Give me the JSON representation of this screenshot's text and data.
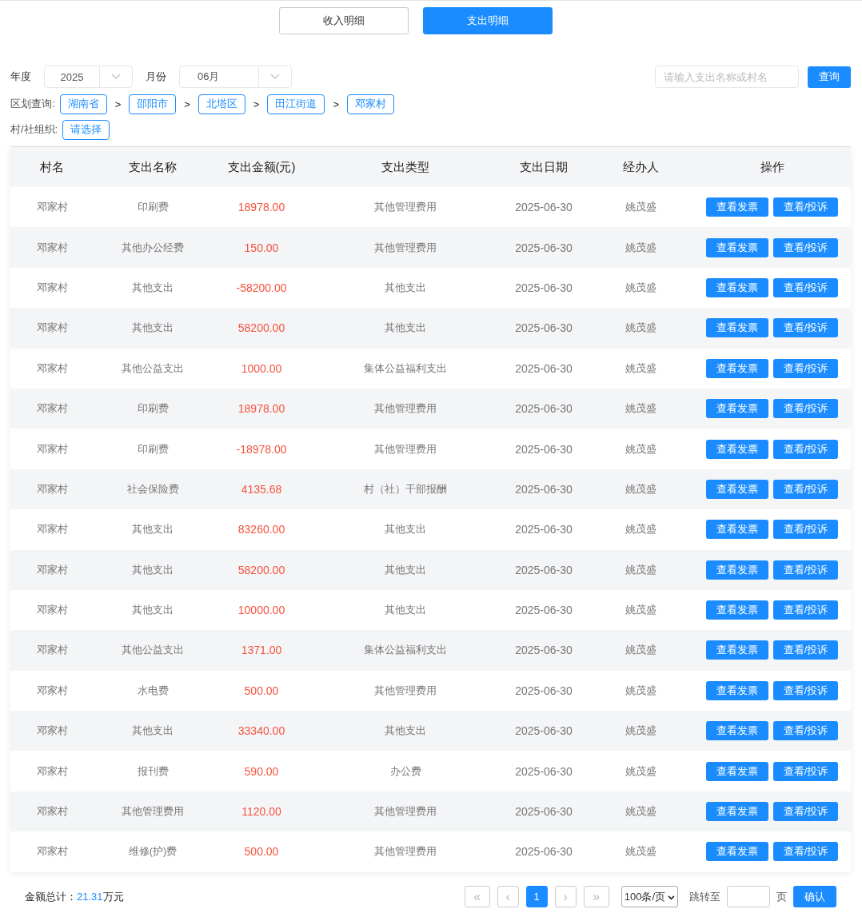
{
  "tabs": [
    {
      "label": "收入明细",
      "selected": false
    },
    {
      "label": "支出明细",
      "selected": true
    }
  ],
  "filters": {
    "year": {
      "label": "年度",
      "value": "2025"
    },
    "month": {
      "label": "月份",
      "value": "06月"
    },
    "search": {
      "placeholder": "请输入支出名称或村名"
    },
    "search_button": "查询"
  },
  "region": {
    "label": "区划查询:",
    "separator": ">",
    "items": [
      "湖南省",
      "邵阳市",
      "北塔区",
      "田江街道",
      "邓家村"
    ]
  },
  "organization": {
    "label": "村/社组织:",
    "value": "请选择"
  },
  "table": {
    "columns": [
      "村名",
      "支出名称",
      "支出金额(元)",
      "支出类型",
      "支出日期",
      "经办人",
      "操作"
    ],
    "rows": [
      {
        "village": "邓家村",
        "name": "印刷费",
        "amount": "18978.00",
        "type": "其他管理费用",
        "date": "2025-06-30",
        "handler": "姚茂盛",
        "actions": [
          "查看发票",
          "查看/投诉"
        ]
      },
      {
        "village": "邓家村",
        "name": "其他办公经费",
        "amount": "150.00",
        "type": "其他管理费用",
        "date": "2025-06-30",
        "handler": "姚茂盛",
        "actions": [
          "查看发票",
          "查看/投诉"
        ]
      },
      {
        "village": "邓家村",
        "name": "其他支出",
        "amount": "-58200.00",
        "type": "其他支出",
        "date": "2025-06-30",
        "handler": "姚茂盛",
        "actions": [
          "查看发票",
          "查看/投诉"
        ]
      },
      {
        "village": "邓家村",
        "name": "其他支出",
        "amount": "58200.00",
        "type": "其他支出",
        "date": "2025-06-30",
        "handler": "姚茂盛",
        "actions": [
          "查看发票",
          "查看/投诉"
        ]
      },
      {
        "village": "邓家村",
        "name": "其他公益支出",
        "amount": "1000.00",
        "type": "集体公益福利支出",
        "date": "2025-06-30",
        "handler": "姚茂盛",
        "actions": [
          "查看发票",
          "查看/投诉"
        ]
      },
      {
        "village": "邓家村",
        "name": "印刷费",
        "amount": "18978.00",
        "type": "其他管理费用",
        "date": "2025-06-30",
        "handler": "姚茂盛",
        "actions": [
          "查看发票",
          "查看/投诉"
        ]
      },
      {
        "village": "邓家村",
        "name": "印刷费",
        "amount": "-18978.00",
        "type": "其他管理费用",
        "date": "2025-06-30",
        "handler": "姚茂盛",
        "actions": [
          "查看发票",
          "查看/投诉"
        ]
      },
      {
        "village": "邓家村",
        "name": "社会保险费",
        "amount": "4135.68",
        "type": "村（社）干部报酬",
        "date": "2025-06-30",
        "handler": "姚茂盛",
        "actions": [
          "查看发票",
          "查看/投诉"
        ]
      },
      {
        "village": "邓家村",
        "name": "其他支出",
        "amount": "83260.00",
        "type": "其他支出",
        "date": "2025-06-30",
        "handler": "姚茂盛",
        "actions": [
          "查看发票",
          "查看/投诉"
        ]
      },
      {
        "village": "邓家村",
        "name": "其他支出",
        "amount": "58200.00",
        "type": "其他支出",
        "date": "2025-06-30",
        "handler": "姚茂盛",
        "actions": [
          "查看发票",
          "查看/投诉"
        ]
      },
      {
        "village": "邓家村",
        "name": "其他支出",
        "amount": "10000.00",
        "type": "其他支出",
        "date": "2025-06-30",
        "handler": "姚茂盛",
        "actions": [
          "查看发票",
          "查看/投诉"
        ]
      },
      {
        "village": "邓家村",
        "name": "其他公益支出",
        "amount": "1371.00",
        "type": "集体公益福利支出",
        "date": "2025-06-30",
        "handler": "姚茂盛",
        "actions": [
          "查看发票",
          "查看/投诉"
        ]
      },
      {
        "village": "邓家村",
        "name": "水电费",
        "amount": "500.00",
        "type": "其他管理费用",
        "date": "2025-06-30",
        "handler": "姚茂盛",
        "actions": [
          "查看发票",
          "查看/投诉"
        ]
      },
      {
        "village": "邓家村",
        "name": "其他支出",
        "amount": "33340.00",
        "type": "其他支出",
        "date": "2025-06-30",
        "handler": "姚茂盛",
        "actions": [
          "查看发票",
          "查看/投诉"
        ]
      },
      {
        "village": "邓家村",
        "name": "报刊费",
        "amount": "590.00",
        "type": "办公费",
        "date": "2025-06-30",
        "handler": "姚茂盛",
        "actions": [
          "查看发票",
          "查看/投诉"
        ]
      },
      {
        "village": "邓家村",
        "name": "其他管理费用",
        "amount": "1120.00",
        "type": "其他管理费用",
        "date": "2025-06-30",
        "handler": "姚茂盛",
        "actions": [
          "查看发票",
          "查看/投诉"
        ]
      },
      {
        "village": "邓家村",
        "name": "维修(护)费",
        "amount": "500.00",
        "type": "其他管理费用",
        "date": "2025-06-30",
        "handler": "姚茂盛",
        "actions": [
          "查看发票",
          "查看/投诉"
        ]
      }
    ]
  },
  "footer": {
    "total_label": "金额总计：",
    "total_value": "21.31",
    "total_unit": "万元",
    "pagination": {
      "first": "«",
      "prev": "‹",
      "pages": [
        {
          "label": "1",
          "selected": true
        }
      ],
      "next": "›",
      "last": "»"
    },
    "page_size": "100条/页",
    "jump_label": "跳转至",
    "page_unit": "页",
    "confirm": "确认"
  }
}
